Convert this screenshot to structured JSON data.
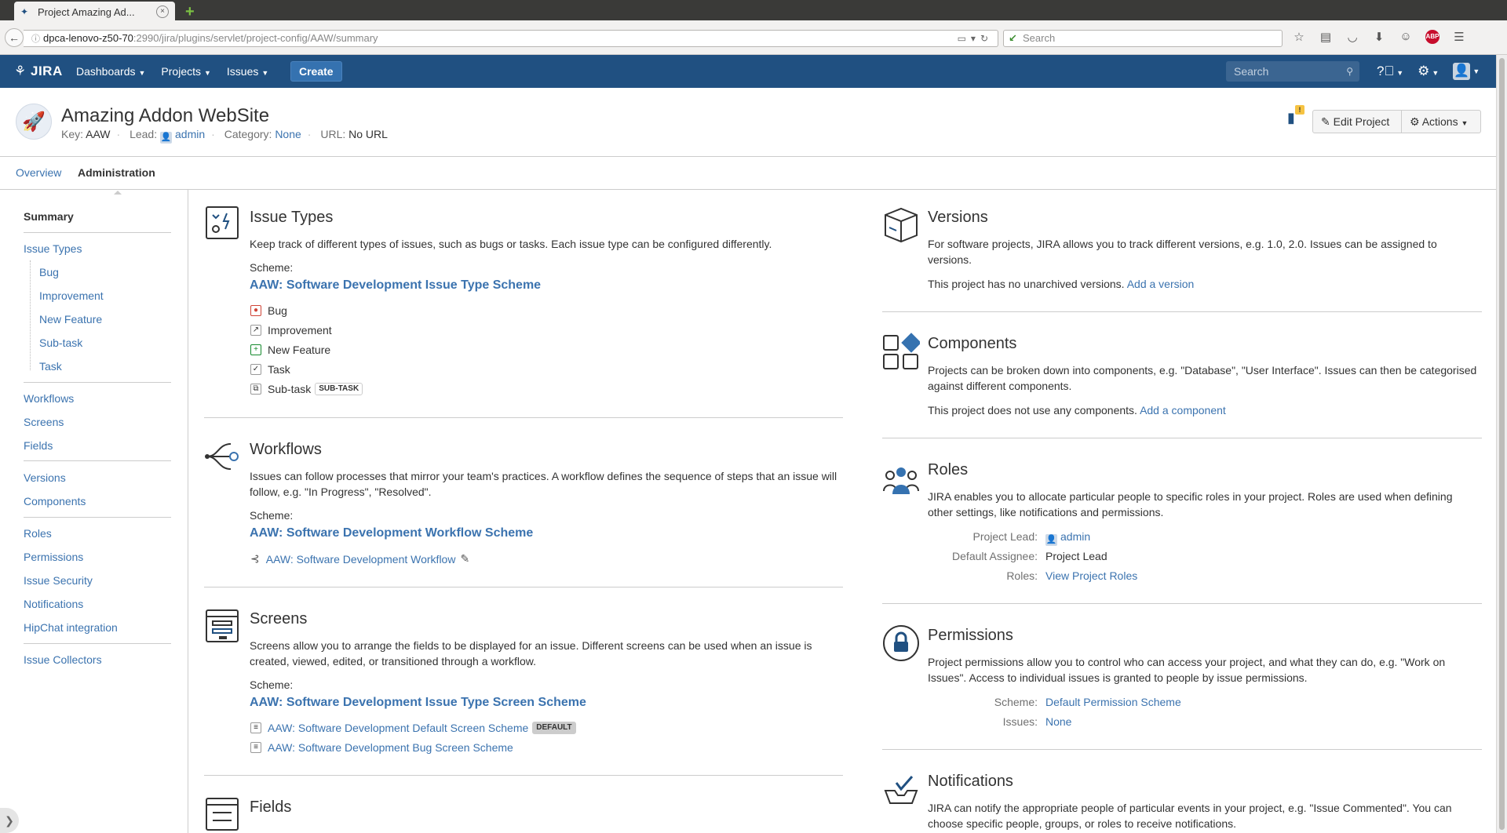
{
  "browser": {
    "tab_title": "Project Amazing Ad...",
    "tab_close": "×",
    "new_tab": "+",
    "url_host": "dpca-lenovo-z50-70",
    "url_path": ":2990/jira/plugins/servlet/project-config/AAW/summary",
    "search_placeholder": "Search"
  },
  "jira_header": {
    "logo": "JIRA",
    "nav": [
      {
        "label": "Dashboards"
      },
      {
        "label": "Projects"
      },
      {
        "label": "Issues"
      }
    ],
    "create_label": "Create",
    "search_placeholder": "Search"
  },
  "project": {
    "name": "Amazing Addon WebSite",
    "key_label": "Key:",
    "key": "AAW",
    "lead_label": "Lead:",
    "lead": "admin",
    "category_label": "Category:",
    "category": "None",
    "url_label": "URL:",
    "url": "No URL",
    "edit_label": "Edit Project",
    "actions_label": "Actions"
  },
  "page_tabs": {
    "overview": "Overview",
    "administration": "Administration"
  },
  "sidebar": {
    "summary": "Summary",
    "issue_types": "Issue Types",
    "issue_type_children": [
      "Bug",
      "Improvement",
      "New Feature",
      "Sub-task",
      "Task"
    ],
    "group2": [
      "Workflows",
      "Screens",
      "Fields"
    ],
    "group3": [
      "Versions",
      "Components"
    ],
    "group4": [
      "Roles",
      "Permissions",
      "Issue Security",
      "Notifications",
      "HipChat integration"
    ],
    "group5": [
      "Issue Collectors"
    ]
  },
  "issue_types": {
    "title": "Issue Types",
    "desc": "Keep track of different types of issues, such as bugs or tasks. Each issue type can be configured differently.",
    "scheme_label": "Scheme:",
    "scheme": "AAW: Software Development Issue Type Scheme",
    "items": [
      "Bug",
      "Improvement",
      "New Feature",
      "Task",
      "Sub-task"
    ],
    "subtask_lozenge": "SUB-TASK"
  },
  "workflows": {
    "title": "Workflows",
    "desc": "Issues can follow processes that mirror your team's practices. A workflow defines the sequence of steps that an issue will follow, e.g. \"In Progress\", \"Resolved\".",
    "scheme_label": "Scheme:",
    "scheme": "AAW: Software Development Workflow Scheme",
    "workflow": "AAW: Software Development Workflow"
  },
  "screens": {
    "title": "Screens",
    "desc": "Screens allow you to arrange the fields to be displayed for an issue. Different screens can be used when an issue is created, viewed, edited, or transitioned through a workflow.",
    "scheme_label": "Scheme:",
    "scheme": "AAW: Software Development Issue Type Screen Scheme",
    "items": [
      "AAW: Software Development Default Screen Scheme",
      "AAW: Software Development Bug Screen Scheme"
    ],
    "default_lozenge": "DEFAULT"
  },
  "fields": {
    "title": "Fields"
  },
  "versions": {
    "title": "Versions",
    "desc": "For software projects, JIRA allows you to track different versions, e.g. 1.0, 2.0. Issues can be assigned to versions.",
    "status": "This project has no unarchived versions.",
    "add_link": "Add a version"
  },
  "components": {
    "title": "Components",
    "desc": "Projects can be broken down into components, e.g. \"Database\", \"User Interface\". Issues can then be categorised against different components.",
    "status": "This project does not use any components.",
    "add_link": "Add a component"
  },
  "roles": {
    "title": "Roles",
    "desc": "JIRA enables you to allocate particular people to specific roles in your project. Roles are used when defining other settings, like notifications and permissions.",
    "project_lead_label": "Project Lead:",
    "project_lead": "admin",
    "default_assignee_label": "Default Assignee:",
    "default_assignee": "Project Lead",
    "roles_label": "Roles:",
    "roles_link": "View Project Roles"
  },
  "permissions": {
    "title": "Permissions",
    "desc": "Project permissions allow you to control who can access your project, and what they can do, e.g. \"Work on Issues\". Access to individual issues is granted to people by issue permissions.",
    "scheme_label": "Scheme:",
    "scheme": "Default Permission Scheme",
    "issues_label": "Issues:",
    "issues": "None"
  },
  "notifications": {
    "title": "Notifications",
    "desc": "JIRA can notify the appropriate people of particular events in your project, e.g. \"Issue Commented\". You can choose specific people, groups, or roles to receive notifications."
  }
}
